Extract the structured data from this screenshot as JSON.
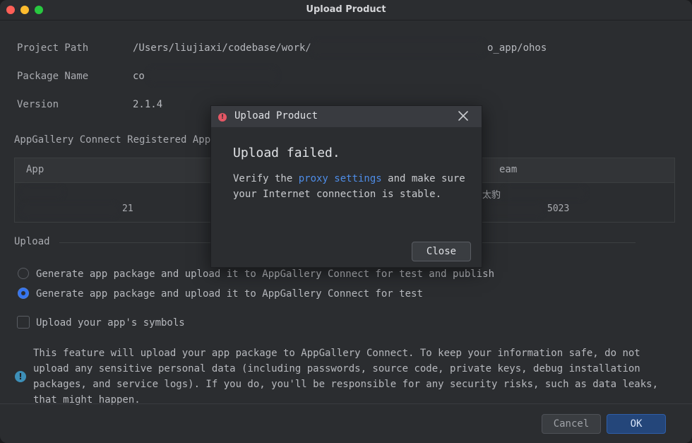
{
  "window": {
    "title": "Upload Product"
  },
  "info": {
    "project_path_label": "Project Path",
    "project_path_prefix": "/Users/liujiaxi/codebase/work/",
    "project_path_suffix": "o_app/ohos",
    "package_name_label": "Package Name",
    "package_name_partial": "co",
    "version_label": "Version",
    "version_value": "2.1.4"
  },
  "registered": {
    "title": "AppGallery Connect Registered App",
    "columns": [
      "App",
      "eam"
    ],
    "row_fragments": [
      "21",
      "太豹",
      "5023"
    ]
  },
  "upload": {
    "title": "Upload",
    "options": [
      {
        "label": "Generate app package and upload it to AppGallery Connect for test and publish",
        "checked": false
      },
      {
        "label": "Generate app package and upload it to AppGallery Connect for test",
        "checked": true
      }
    ],
    "symbols_label": "Upload your app's symbols",
    "symbols_checked": false
  },
  "notice": {
    "icon": "info-icon",
    "lines": [
      "This feature will upload your app package to AppGallery Connect. To keep your information safe, do not",
      "upload any sensitive personal data (including passwords, source code, private keys, debug installation",
      "packages, and service logs). If you do, you'll be responsible for any security risks, such as data leaks,",
      "that might happen."
    ]
  },
  "footer": {
    "cancel": "Cancel",
    "ok": "OK"
  },
  "dialog": {
    "title": "Upload Product",
    "heading": "Upload failed.",
    "body_before": "Verify the ",
    "body_link": "proxy settings",
    "body_after": " and make sure your Internet connection is stable.",
    "close_label": "Close",
    "icon": "error-icon"
  },
  "colors": {
    "accent": "#3574f0",
    "link": "#4e8de8",
    "error": "#e55765",
    "background": "#2b2d30"
  }
}
